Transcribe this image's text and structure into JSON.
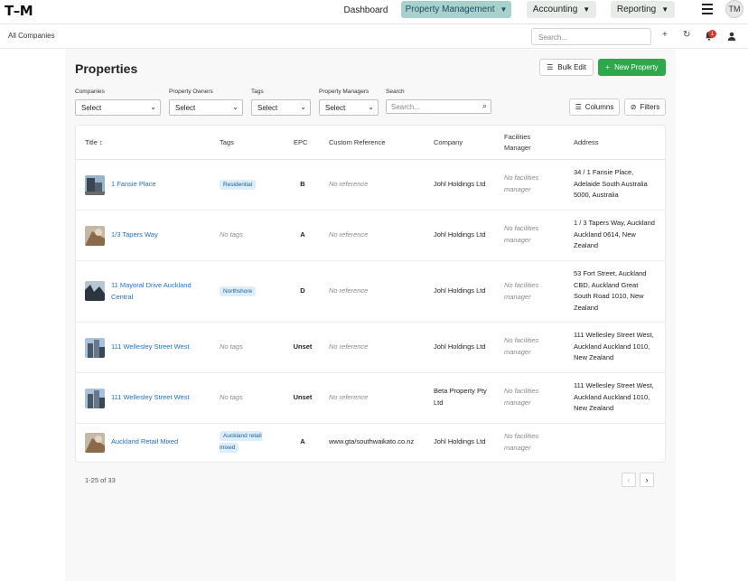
{
  "app": {
    "logo": "T–M"
  },
  "nav": {
    "dashboard": "Dashboard",
    "property_management": "Property Management",
    "accounting": "Accounting",
    "reporting": "Reporting",
    "caret": "▼",
    "avatar": "TM"
  },
  "subbar": {
    "scope": "All Companies",
    "search_placeholder": "Search...",
    "notification_count": "1"
  },
  "page": {
    "title": "Properties",
    "bulk_edit": "Bulk Edit",
    "new_property": "New Property",
    "columns": "Columns",
    "filters": "Filters"
  },
  "filters": {
    "companies": {
      "label": "Companies",
      "value": "Select"
    },
    "owners": {
      "label": "Property Owners",
      "value": "Select"
    },
    "tags": {
      "label": "Tags",
      "value": "Select"
    },
    "managers": {
      "label": "Property Managers",
      "value": "Select"
    },
    "search": {
      "label": "Search",
      "placeholder": "Search..."
    }
  },
  "table": {
    "headers": {
      "title": "Title",
      "tags": "Tags",
      "epc": "EPC",
      "custom_reference": "Custom Reference",
      "company": "Company",
      "facilities_manager": "Facilities Manager",
      "address": "Address"
    },
    "rows": [
      {
        "title": "1 Fansie Place",
        "tag": "Residential",
        "epc": "B",
        "ref": "No reference",
        "company": "Johl Holdings Ltd",
        "fm": "No facilities manager",
        "address": "34 / 1 Fansie Place, Adelaide South Australia 5000, Australia"
      },
      {
        "title": "1/3 Tapers Way",
        "tag": "No tags",
        "epc": "A",
        "ref": "No reference",
        "company": "Johl Holdings Ltd",
        "fm": "No facilities manager",
        "address": "1 / 3 Tapers Way, Auckland Auckland 0614, New Zealand"
      },
      {
        "title": "11 Mayoral Drive Auckland Central",
        "tag": "Northshore",
        "epc": "D",
        "ref": "No reference",
        "company": "Johl Holdings Ltd",
        "fm": "No facilities manager",
        "address": "53 Fort Street, Auckland CBD, Auckland Great South Road 1010, New Zealand"
      },
      {
        "title": "111 Wellesley Street West",
        "tag": "No tags",
        "epc": "Unset",
        "ref": "No reference",
        "company": "Johl Holdings Ltd",
        "fm": "No facilities manager",
        "address": "111 Wellesley Street West, Auckland Auckland 1010, New Zealand"
      },
      {
        "title": "111 Wellesley Street West",
        "tag": "No tags",
        "epc": "Unset",
        "ref": "No reference",
        "company": "Beta Property Pty Ltd",
        "fm": "No facilities manager",
        "address": "111 Wellesley Street West, Auckland Auckland 1010, New Zealand"
      },
      {
        "title": "Auckland Retail Mixed",
        "tag": "Auckland retail mixed",
        "epc": "A",
        "ref": "www.gta/southwaikato.co.nz",
        "company": "Johl Holdings Ltd",
        "fm": "No facilities manager",
        "address": ""
      }
    ]
  },
  "pagination": {
    "summary": "1-25 of 33",
    "prev": "‹",
    "next": "›"
  }
}
